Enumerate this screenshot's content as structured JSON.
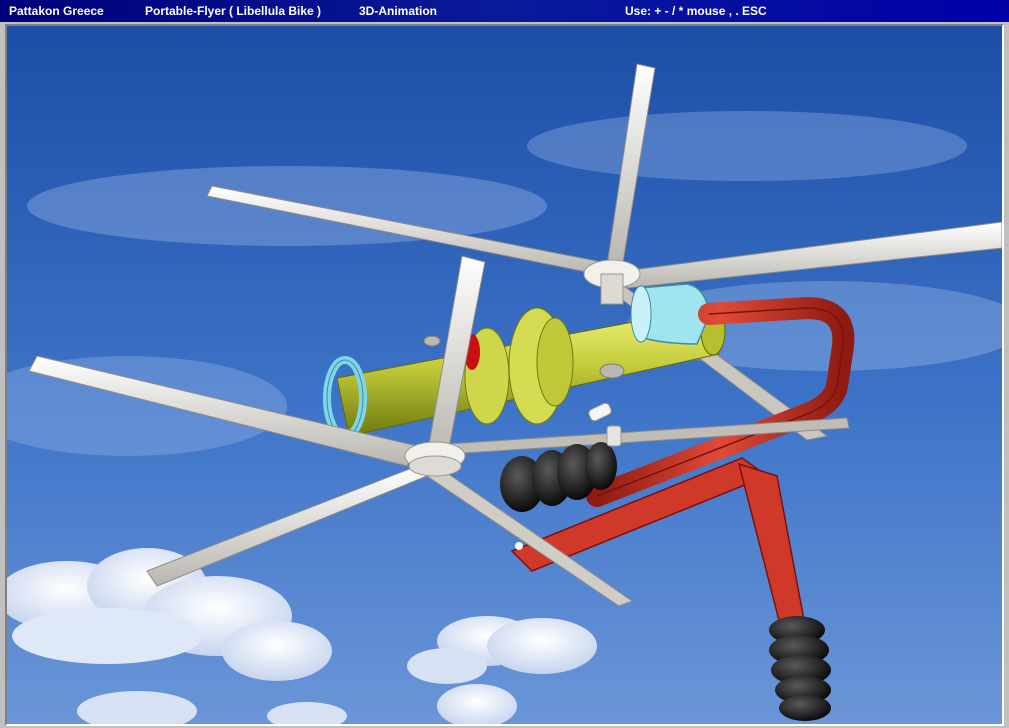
{
  "window": {
    "company": "Pattakon Greece",
    "product": "Portable-Flyer ( Libellula Bike )",
    "mode": "3D-Animation",
    "controls_hint": "Use: + - / * mouse , .  ESC"
  },
  "scene": {
    "description_icons": [
      "rotor-blade",
      "fuselage",
      "handlebar",
      "grip",
      "footrest",
      "cloud"
    ],
    "colors": {
      "sky_top": "#1c4ea8",
      "sky_bottom": "#5b8ad6",
      "fuselage": "#c2cc3c",
      "handlebar": "#d23a2a",
      "grip": "#111111",
      "blade": "#e6e4de",
      "cyan_ring": "#7fd6e6",
      "red_accent": "#c81010"
    }
  }
}
